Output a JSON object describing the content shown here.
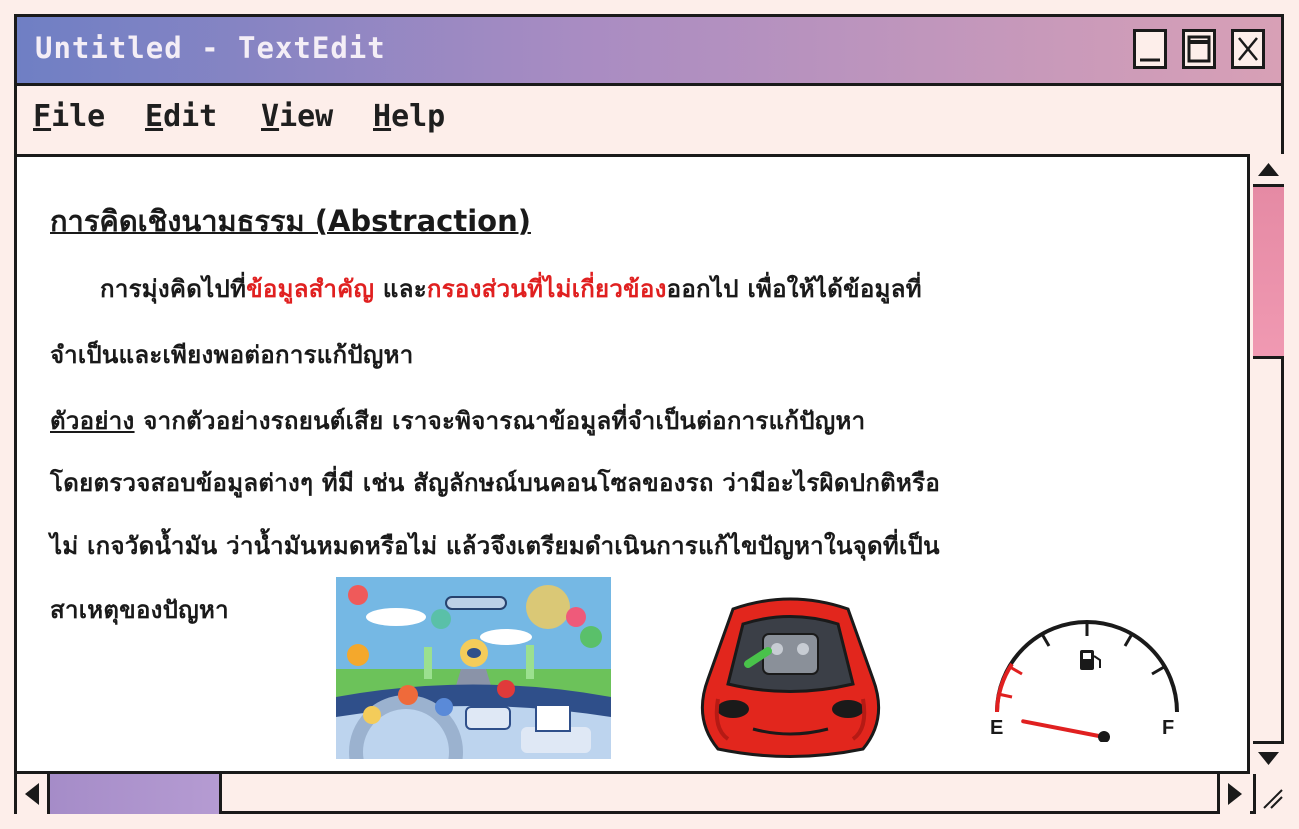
{
  "window": {
    "title": "Untitled - TextEdit",
    "controls": [
      "minimize-icon",
      "maximize-icon",
      "close-icon"
    ]
  },
  "menubar": {
    "items": [
      {
        "first": "F",
        "rest": "ile"
      },
      {
        "first": "E",
        "rest": "dit"
      },
      {
        "first": "V",
        "rest": "iew"
      },
      {
        "first": "H",
        "rest": "elp"
      }
    ]
  },
  "document": {
    "heading": "การคิดเชิงนามธรรม (Abstraction)",
    "p1_a": "การมุ่งคิดไปที่",
    "p1_red1": "ข้อมูลสำคัญ",
    "p1_b": " และ",
    "p1_red2": "กรองส่วนที่ไม่เกี่ยวข้อง",
    "p1_c": "ออกไป เพื่อให้ได้ข้อมูลที่",
    "p2": "จำเป็นและเพียงพอต่อการแก้ปัญหา",
    "example_label": "ตัวอย่าง",
    "p3_rest": " จากตัวอย่างรถยนต์เสีย เราจะพิจารณาข้อมูลที่จำเป็นต่อการแก้ปัญหา",
    "p4": "โดยตรวจสอบข้อมูลต่างๆ ที่มี เช่น สัญลักษณ์บนคอนโซลของรถ ว่ามีอะไรผิดปกติหรือ",
    "p5": "ไม่ เกจวัดน้ำมัน ว่าน้ำมันหมดหรือไม่ แล้วจึงเตรียมดำเนินการแก้ไขปัญหาในจุดที่เป็น",
    "p6": "สาเหตุของปัญหา",
    "gauge": {
      "empty_label": "E",
      "full_label": "F",
      "level": 0.05
    }
  },
  "colors": {
    "title_gradient_start": "#6f7fc4",
    "title_gradient_end": "#d8a0b6",
    "highlight_red": "#e02020",
    "vscroll_thumb": "#e58aa4",
    "hscroll_thumb": "#a58cc8"
  }
}
